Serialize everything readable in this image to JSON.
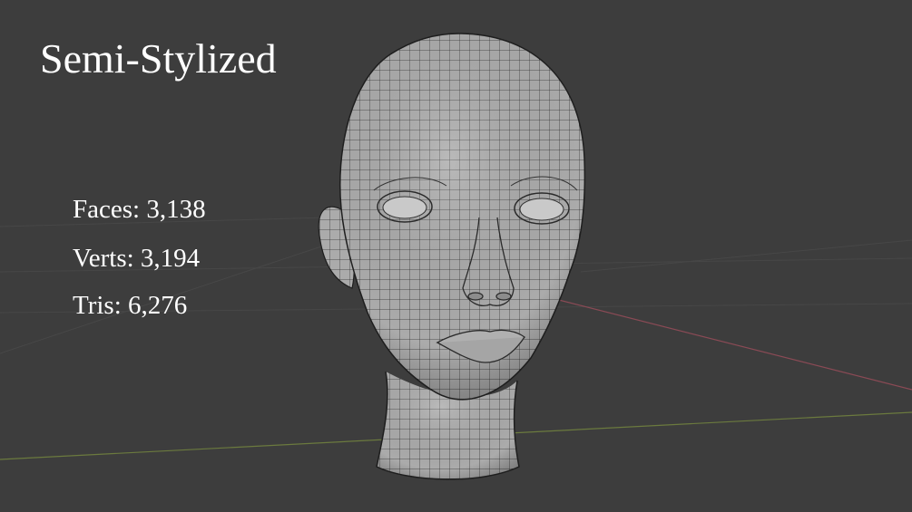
{
  "viewport": {
    "title": "Semi-Stylized",
    "stats": {
      "faces": "Faces: 3,138",
      "verts": "Verts: 3,194",
      "tris": "Tris: 6,276"
    }
  },
  "colors": {
    "background": "#3d3d3d",
    "grid_line": "#4a4a4a",
    "x_axis": "#8a4a55",
    "y_axis": "#6b7a3e",
    "mesh_fill": "#a9a9a9",
    "mesh_wire": "#2a2a2a",
    "text": "#ffffff"
  },
  "icons": {
    "model": "head-mesh-icon"
  }
}
